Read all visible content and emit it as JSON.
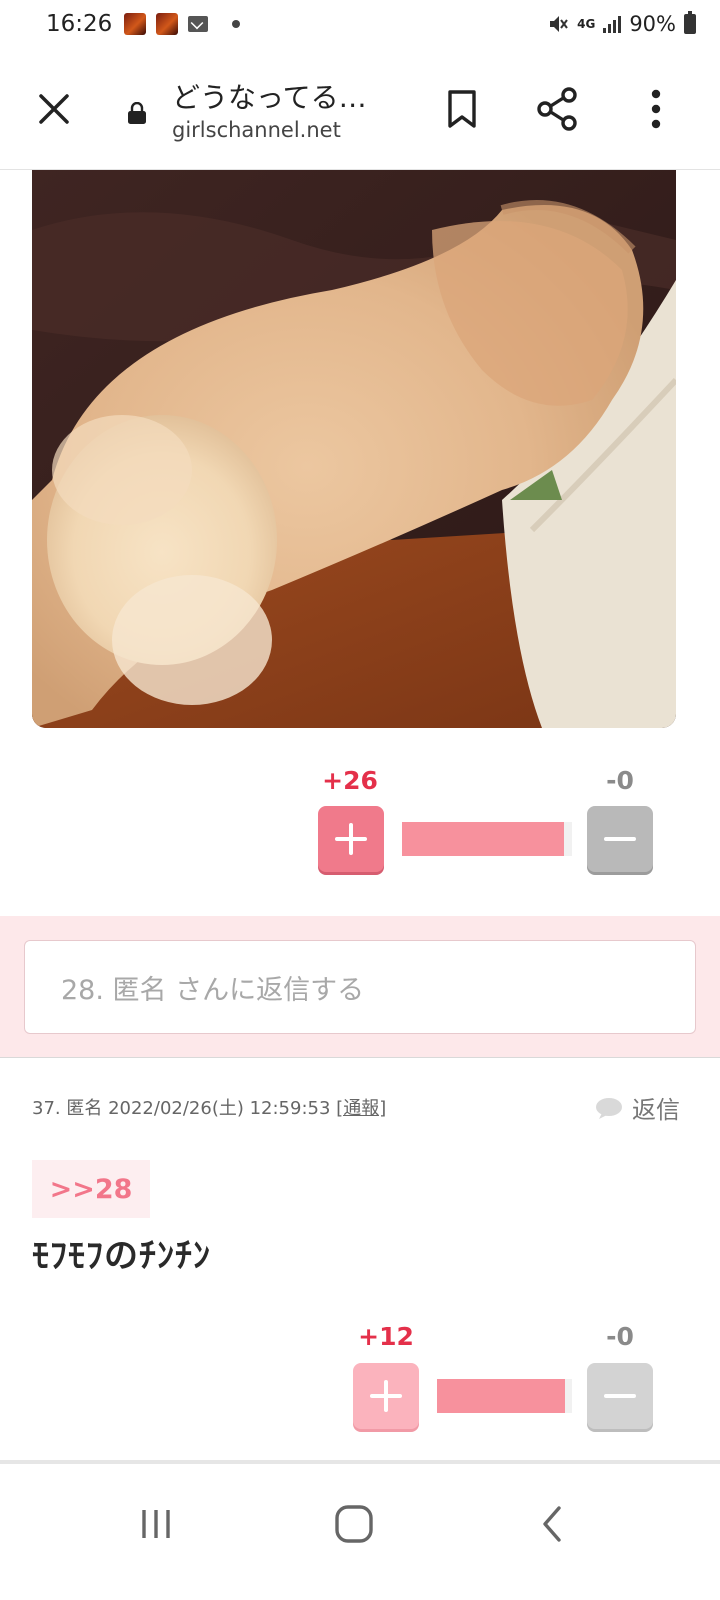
{
  "status_bar": {
    "time": "16:26",
    "network": "4G",
    "battery": "90%"
  },
  "browser": {
    "title": "どうなってる…",
    "url": "girlschannel.net"
  },
  "post_28": {
    "plus_count": "+26",
    "minus_count": "-0",
    "vote_ratio": 1.0
  },
  "reply_box": {
    "placeholder": "28. 匿名 さんに返信する"
  },
  "comment_37": {
    "meta": "37. 匿名 2022/02/26(土) 12:59:53",
    "report_label": "[通報]",
    "reply_label": "返信",
    "anchor": ">>28",
    "body": "ﾓﾌﾓﾌのﾁﾝﾁﾝ",
    "plus_count": "+12",
    "minus_count": "-0",
    "vote_ratio": 1.0
  }
}
